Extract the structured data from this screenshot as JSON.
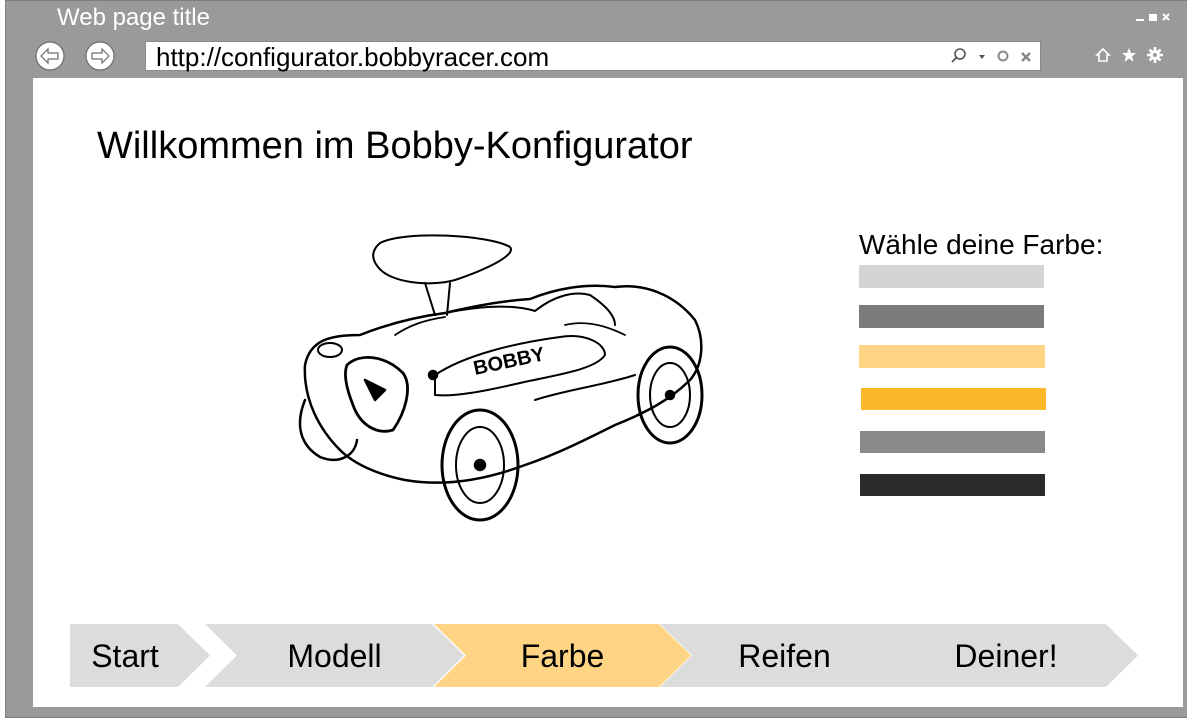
{
  "browser": {
    "window_title": "Web page title",
    "url": "http://configurator.bobbyracer.com",
    "window_controls": [
      "minimize-icon",
      "maximize-icon",
      "close-icon"
    ],
    "nav_icons": [
      "back-arrow-icon",
      "forward-arrow-icon"
    ],
    "address_bar_icons": [
      "search-icon",
      "dropdown-icon",
      "refresh-icon",
      "stop-icon"
    ],
    "toolbar_icons": [
      "home-icon",
      "star-icon",
      "gear-icon"
    ]
  },
  "page": {
    "title": "Willkommen im Bobby-Konfigurator",
    "car_image_icon": "bobby-car-image"
  },
  "color_picker": {
    "label": "Wähle deine Farbe:",
    "swatches": [
      {
        "color": "#d4d4d4"
      },
      {
        "color": "#7b7b7b"
      },
      {
        "color": "#ffd485"
      },
      {
        "color": "#fbb829"
      },
      {
        "color": "#8a8a8c"
      },
      {
        "color": "#2a2a2a"
      }
    ]
  },
  "steps": {
    "items": [
      {
        "label": "Start",
        "color": "#dcdcdc"
      },
      {
        "label": "Modell",
        "color": "#dcdcdc"
      },
      {
        "label": "Farbe",
        "color": "#ffd485",
        "active": true
      },
      {
        "label": "Reifen",
        "color": "#dcdcdc"
      },
      {
        "label": "Deiner!",
        "color": "#dcdcdc"
      }
    ]
  }
}
